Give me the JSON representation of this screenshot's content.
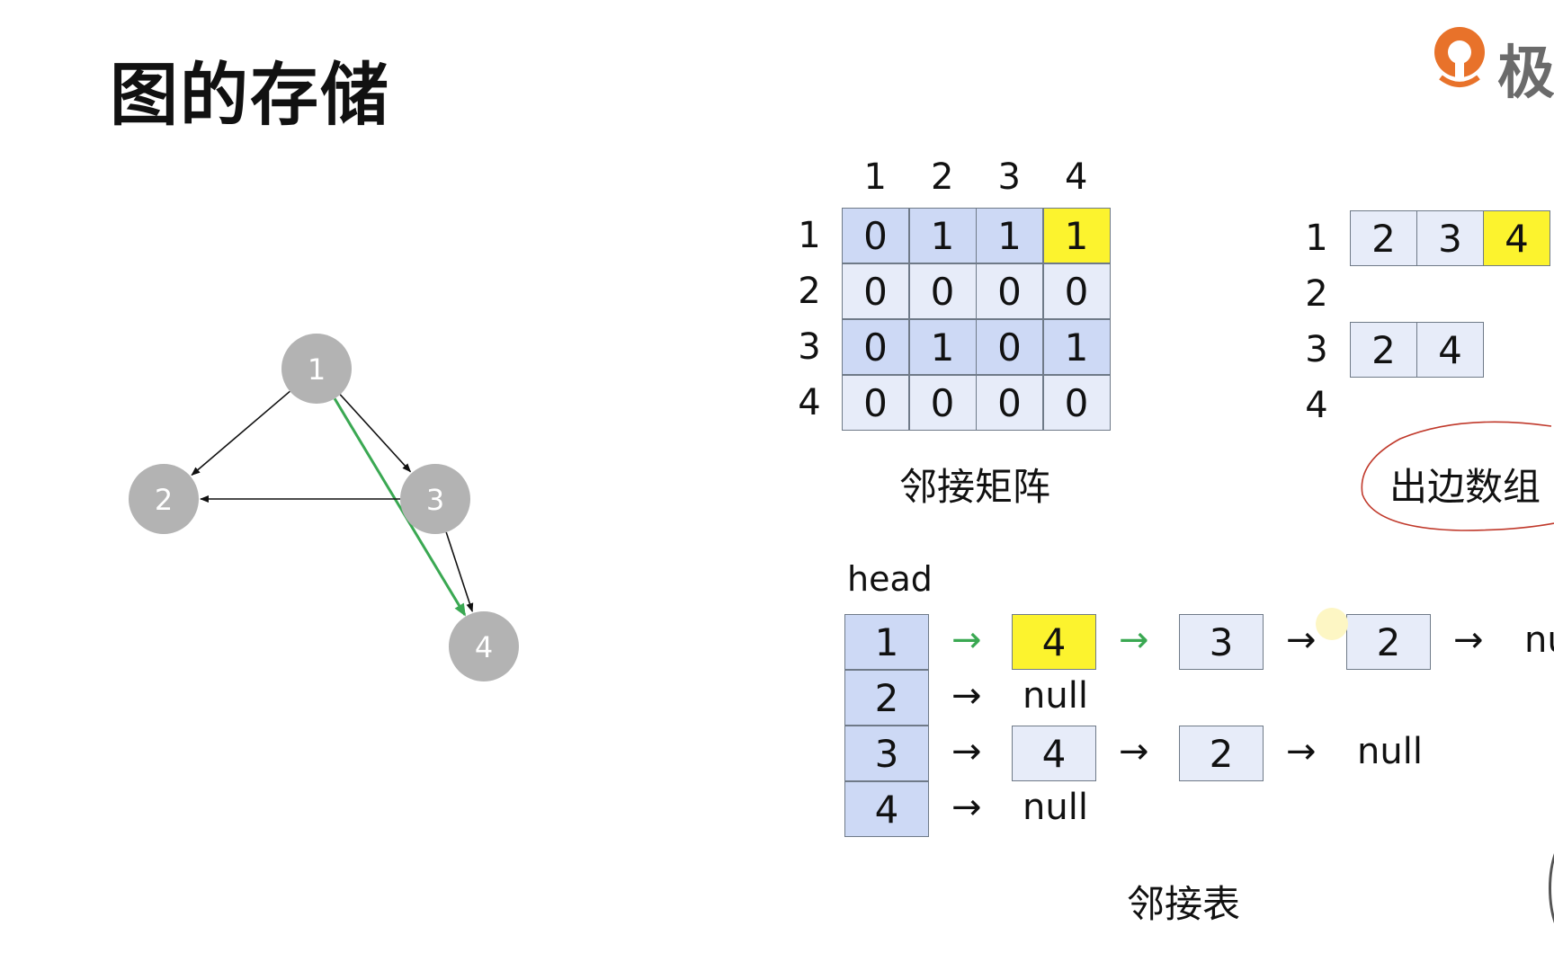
{
  "title": "图的存储",
  "logo_text": "极",
  "graph": {
    "nodes": [
      {
        "id": "1",
        "label": "1"
      },
      {
        "id": "2",
        "label": "2"
      },
      {
        "id": "3",
        "label": "3"
      },
      {
        "id": "4",
        "label": "4"
      }
    ],
    "edges": [
      {
        "from": "1",
        "to": "2",
        "highlight": false
      },
      {
        "from": "1",
        "to": "3",
        "highlight": false
      },
      {
        "from": "1",
        "to": "4",
        "highlight": true
      },
      {
        "from": "3",
        "to": "2",
        "highlight": false
      },
      {
        "from": "3",
        "to": "4",
        "highlight": false
      }
    ],
    "node_color": "#b3b3b3",
    "highlight_color": "#3aa852"
  },
  "matrix": {
    "col_headers": [
      "1",
      "2",
      "3",
      "4"
    ],
    "row_headers": [
      "1",
      "2",
      "3",
      "4"
    ],
    "rows": [
      [
        "0",
        "1",
        "1",
        "1"
      ],
      [
        "0",
        "0",
        "0",
        "0"
      ],
      [
        "0",
        "1",
        "0",
        "1"
      ],
      [
        "0",
        "0",
        "0",
        "0"
      ]
    ],
    "highlight": {
      "row": 0,
      "col": 3
    },
    "caption": "邻接矩阵"
  },
  "out_edges": {
    "row_labels": [
      "1",
      "2",
      "3",
      "4"
    ],
    "rows": [
      [
        "2",
        "3",
        "4"
      ],
      [],
      [
        "2",
        "4"
      ],
      []
    ],
    "highlight": {
      "row": 0,
      "col": 2
    },
    "caption": "出边数组"
  },
  "adj_list": {
    "head_label": "head",
    "heads": [
      "1",
      "2",
      "3",
      "4"
    ],
    "rows": [
      {
        "items": [
          "4",
          "3",
          "2"
        ],
        "tail": "nu"
      },
      {
        "items": [],
        "tail": "null"
      },
      {
        "items": [
          "4",
          "2"
        ],
        "tail": "null"
      },
      {
        "items": [],
        "tail": "null"
      }
    ],
    "arrow": "→",
    "caption": "邻接表"
  },
  "colors": {
    "highlight_yellow": "#fcf32e",
    "cell_light": "#e7ecf9",
    "cell_dark": "#cdd9f5",
    "annotation_red": "#c0392b"
  }
}
